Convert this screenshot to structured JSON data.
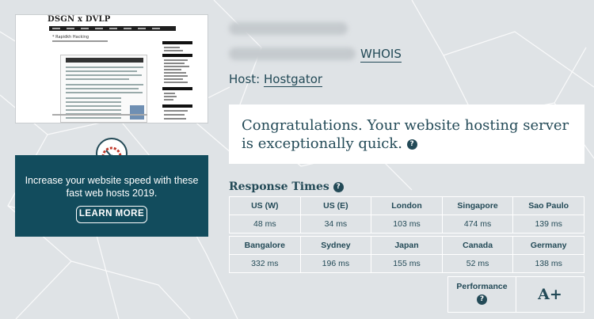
{
  "thumbnail": {
    "site_title": "DSGN x DVLP",
    "heading": "* Rapidkh Hacking"
  },
  "promo": {
    "text": "Increase your website speed with these fast web hosts 2019.",
    "button_label": "LEARN MORE"
  },
  "site_info": {
    "whois_label": "WHOIS",
    "host_label": "Host:",
    "host_name": "Hostgator"
  },
  "result": {
    "message": "Congratulations. Your website hosting server is exceptionally quick."
  },
  "response_times": {
    "title": "Response Times",
    "row1": [
      {
        "location": "US (W)",
        "time": "48 ms"
      },
      {
        "location": "US (E)",
        "time": "34 ms"
      },
      {
        "location": "London",
        "time": "103 ms"
      },
      {
        "location": "Singapore",
        "time": "474 ms"
      },
      {
        "location": "Sao Paulo",
        "time": "139 ms"
      }
    ],
    "row2": [
      {
        "location": "Bangalore",
        "time": "332 ms"
      },
      {
        "location": "Sydney",
        "time": "196 ms"
      },
      {
        "location": "Japan",
        "time": "155 ms"
      },
      {
        "location": "Canada",
        "time": "52 ms"
      },
      {
        "location": "Germany",
        "time": "138 ms"
      }
    ]
  },
  "performance": {
    "label": "Performance",
    "grade": "A+"
  },
  "icons": {
    "help": "question-circle-icon",
    "gauge": "speedometer-icon"
  },
  "colors": {
    "accent": "#234a57",
    "promo_bg": "#124c5d",
    "background": "#dfe3e6"
  }
}
